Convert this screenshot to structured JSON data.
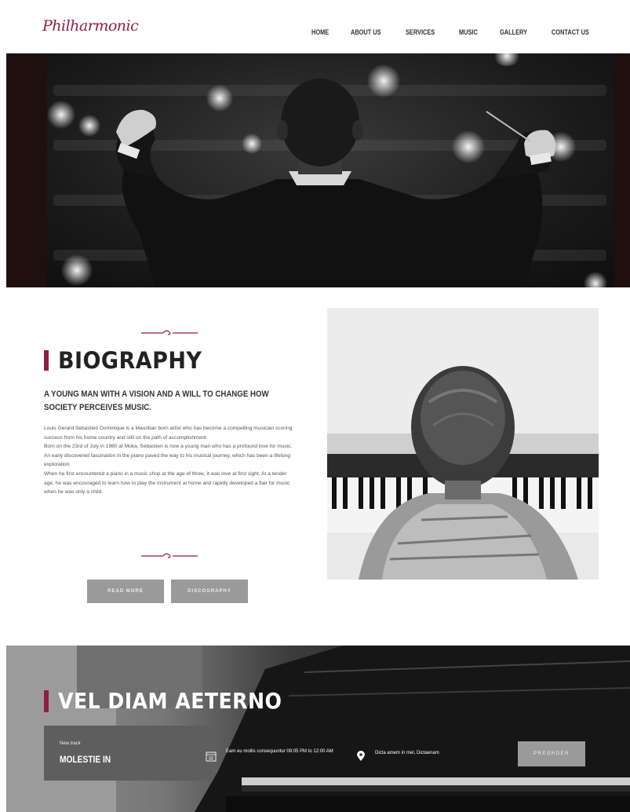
{
  "header": {
    "logo_text": "Philharmonic",
    "nav": [
      "HOME",
      "ABOUT US",
      "SERVICES",
      "MUSIC",
      "GALLERY",
      "CONTACT US"
    ]
  },
  "biography": {
    "title": "BIOGRAPHY",
    "subtitle": "A YOUNG MAN WITH A VISION AND A WILL TO CHANGE HOW SOCIETY PERCEIVES MUSIC.",
    "paragraphs": [
      "Louis Gerard Sebastien Dominique is a Mauritian born artist who has become a compelling musician scoring success from his home country and still on the path of accomplishment.",
      "Born on the 23rd of July in 1980 at Moka, Sebastien is now a young man who has a profound love for music. An early discovered fascination in the piano paved the way to his musical journey, which has been a lifelong exploration.",
      "When he first encountered a piano in a music shop at the age of three, it was love at first sight. At a tender age, he was encouraged to learn how to play the instrument at home and rapidly developed a flair for music when he was only a child."
    ],
    "read_more": "READ MORE",
    "discography": "DISCOGRAPHY"
  },
  "release": {
    "title": "VEL DIAM AETERNO",
    "track_label": "New track",
    "track_name": "MOLESTIE IN",
    "date_text": "Eam eu mollis consequuntur 08:05 PM to 12:00 AM",
    "location_text": "Dicta amem in mel, Dictaenam",
    "preorder": "PREORDER"
  },
  "colors": {
    "accent": "#8e1d46",
    "button_grey": "#9a9a9a"
  }
}
